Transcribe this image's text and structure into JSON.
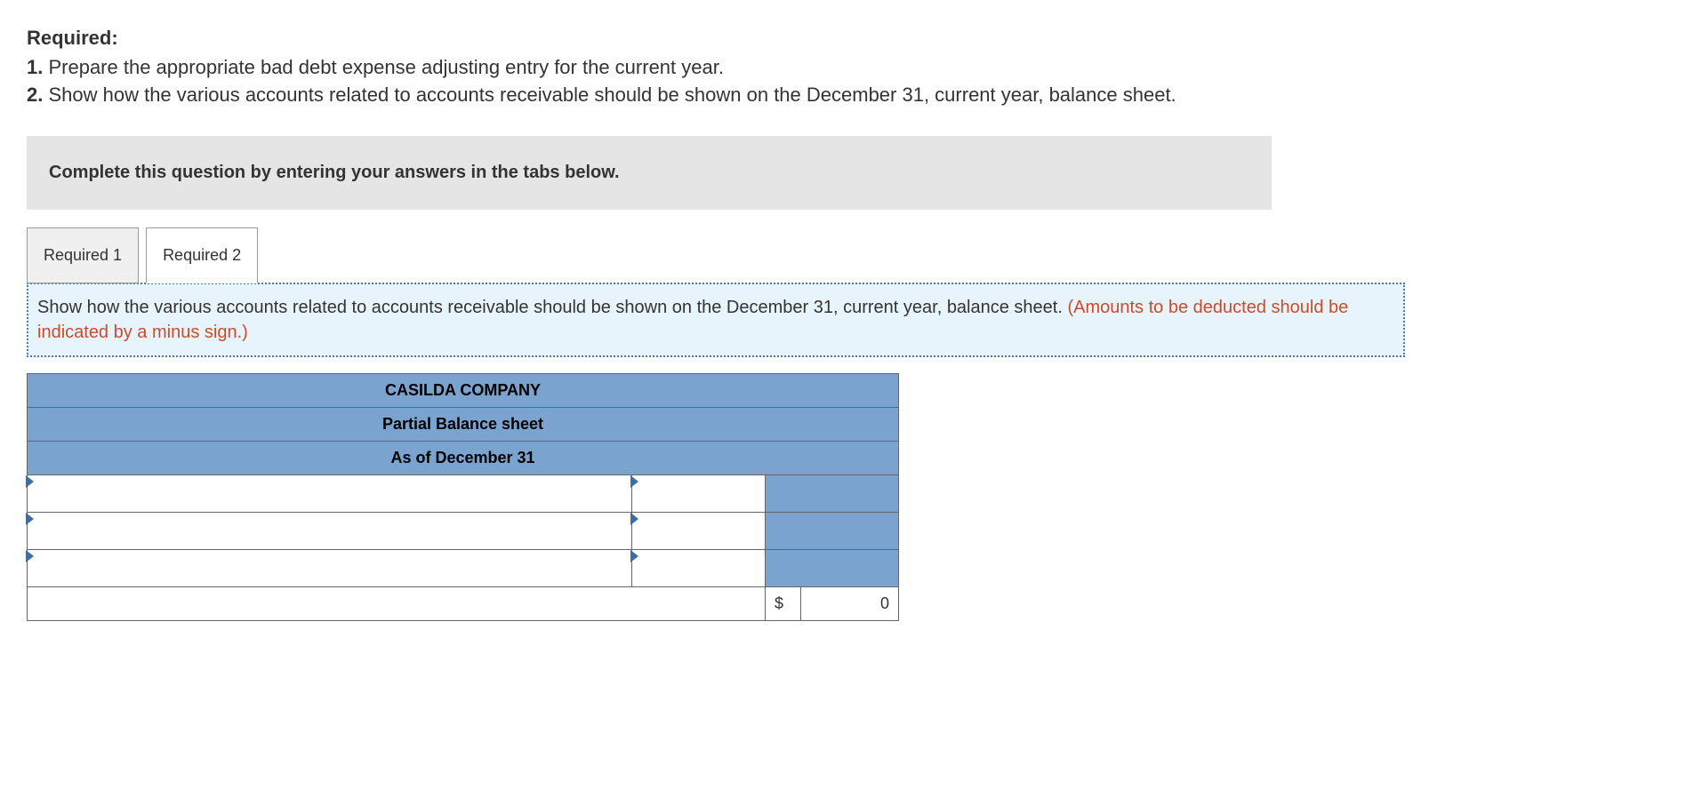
{
  "required": {
    "heading": "Required:",
    "item1_number": "1.",
    "item1_text": " Prepare the appropriate bad debt expense adjusting entry for the current year.",
    "item2_number": "2.",
    "item2_text": " Show how the various accounts related to accounts receivable should be shown on the December 31, current year, balance sheet."
  },
  "instruction_box": "Complete this question by entering your answers in the tabs below.",
  "tabs": {
    "tab1": "Required 1",
    "tab2": "Required 2"
  },
  "tab_content": {
    "main_text": "Show how the various accounts related to accounts receivable should be shown on the December 31, current year, balance sheet. ",
    "red_text": "(Amounts to be deducted should be indicated by a minus sign.)"
  },
  "worksheet": {
    "header1": "CASILDA COMPANY",
    "header2": "Partial Balance sheet",
    "header3": "As of December 31",
    "total_currency": "$",
    "total_value": "0"
  }
}
